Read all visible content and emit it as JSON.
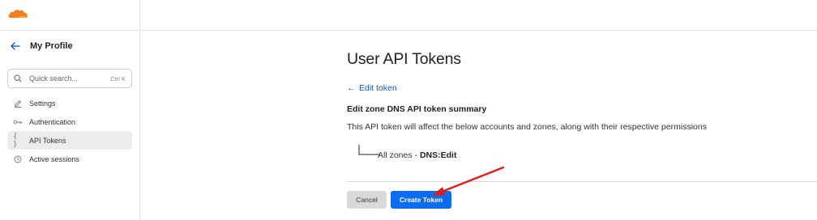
{
  "sidebar": {
    "logo_icon": "cloudflare-logo",
    "back_icon": "arrow-left-icon",
    "title": "My Profile",
    "search": {
      "placeholder": "Quick search...",
      "shortcut": "Ctrl K"
    },
    "items": [
      {
        "icon": "pencil-icon",
        "label": "Settings",
        "active": false
      },
      {
        "icon": "key-icon",
        "label": "Authentication",
        "active": false
      },
      {
        "icon": "braces-icon",
        "label": "API Tokens",
        "active": true
      },
      {
        "icon": "clock-icon",
        "label": "Active sessions",
        "active": false
      }
    ]
  },
  "main": {
    "title": "User API Tokens",
    "back_link": "Edit token",
    "summary_heading": "Edit zone DNS API token summary",
    "summary_description": "This API token will affect the below accounts and zones, along with their respective permissions",
    "zone": {
      "name": "All zones",
      "separator": " - ",
      "permission": "DNS:Edit"
    },
    "buttons": {
      "cancel": "Cancel",
      "create": "Create Token"
    }
  },
  "colors": {
    "accent": "#0a6cf2",
    "link": "#0b56c5",
    "logo": "#f38020",
    "annotation_arrow": "#e31b1b"
  }
}
